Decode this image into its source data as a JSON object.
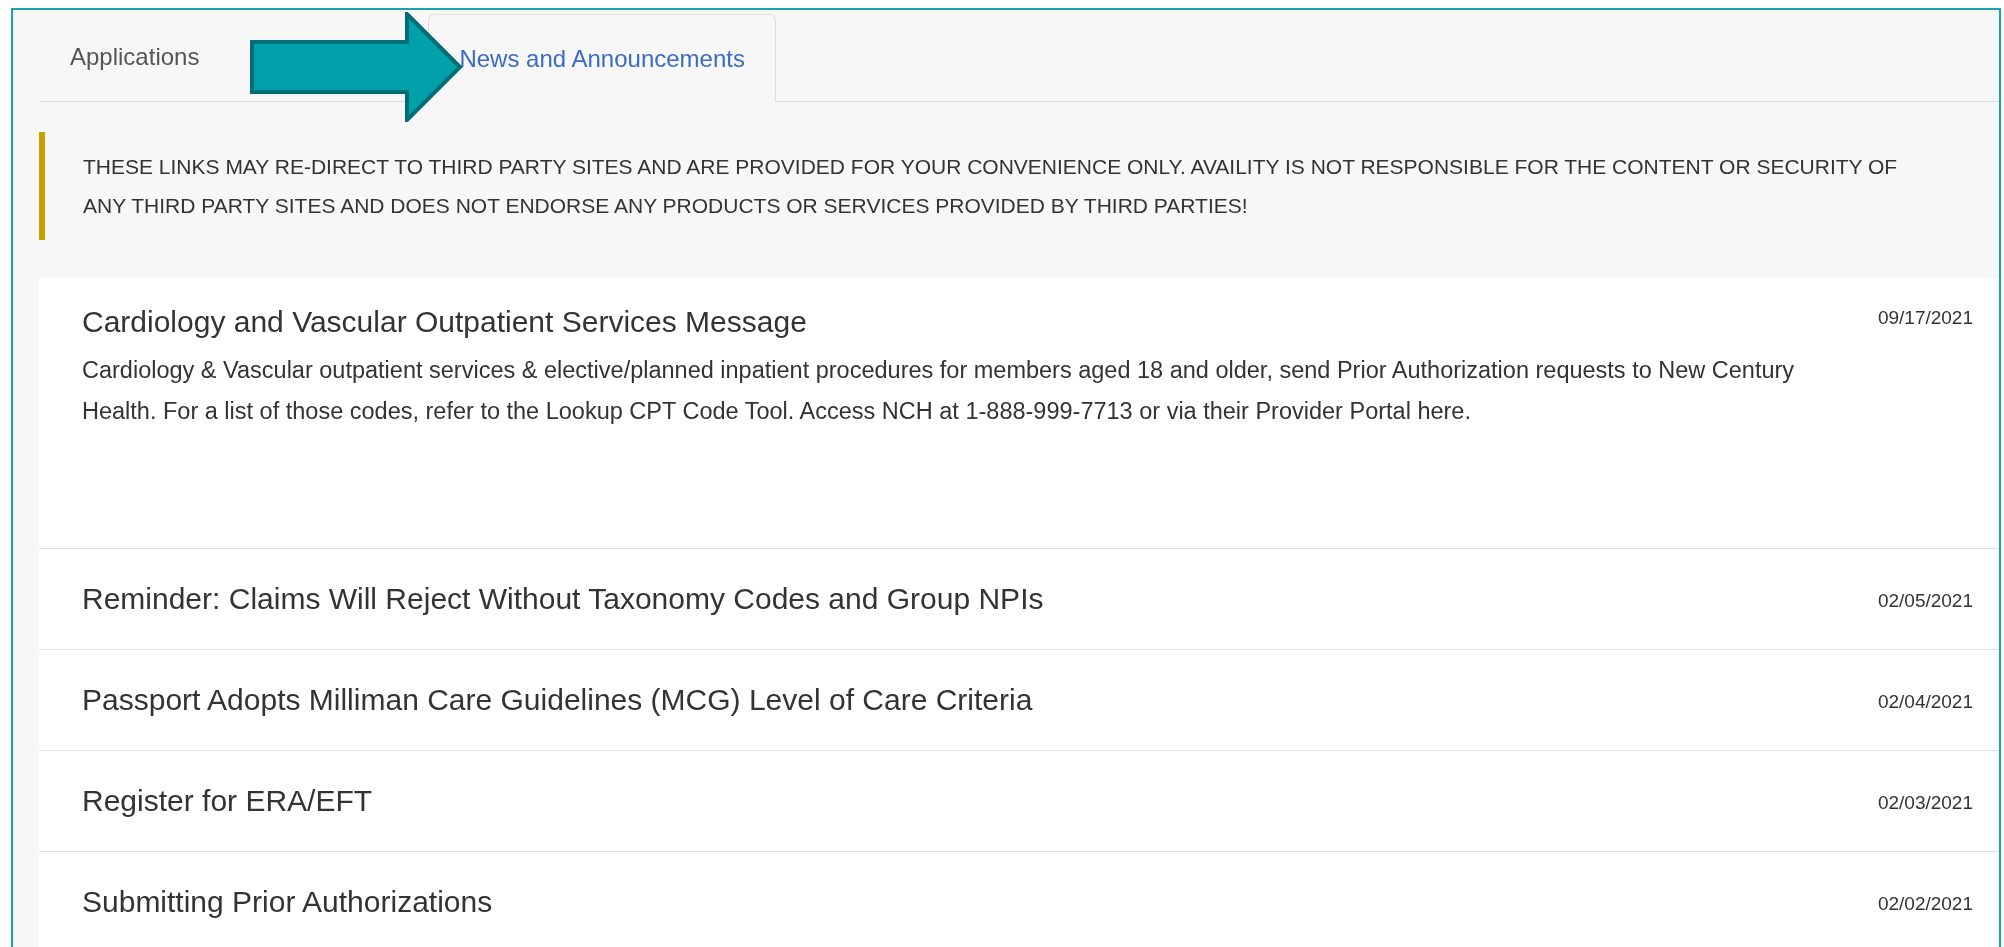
{
  "tabs": [
    {
      "label": "Applications",
      "selected": false
    },
    {
      "label": "News and Announcements",
      "selected": true
    }
  ],
  "notice": "THESE LINKS MAY RE-DIRECT TO THIRD PARTY SITES AND ARE PROVIDED FOR YOUR CONVENIENCE ONLY. AVAILITY IS NOT RESPONSIBLE FOR THE CONTENT OR SECURITY OF ANY THIRD PARTY SITES AND DOES NOT ENDORSE ANY PRODUCTS OR SERVICES PROVIDED BY THIRD PARTIES!",
  "news": [
    {
      "title": "Cardiology and Vascular Outpatient Services Message",
      "date": "09/17/2021",
      "body": "Cardiology & Vascular outpatient services & elective/planned inpatient procedures for members aged 18 and older, send Prior Authorization requests to New Century Health. For a list of those codes, refer to the Lookup CPT Code Tool. Access NCH at 1-888-999-7713 or via their Provider Portal here."
    },
    {
      "title": "Reminder: Claims Will Reject Without Taxonomy Codes and Group NPIs",
      "date": "02/05/2021"
    },
    {
      "title": "Passport Adopts Milliman Care Guidelines (MCG) Level of Care Criteria",
      "date": "02/04/2021"
    },
    {
      "title": "Register for ERA/EFT",
      "date": "02/03/2021"
    },
    {
      "title": "Submitting Prior Authorizations",
      "date": "02/02/2021"
    }
  ]
}
